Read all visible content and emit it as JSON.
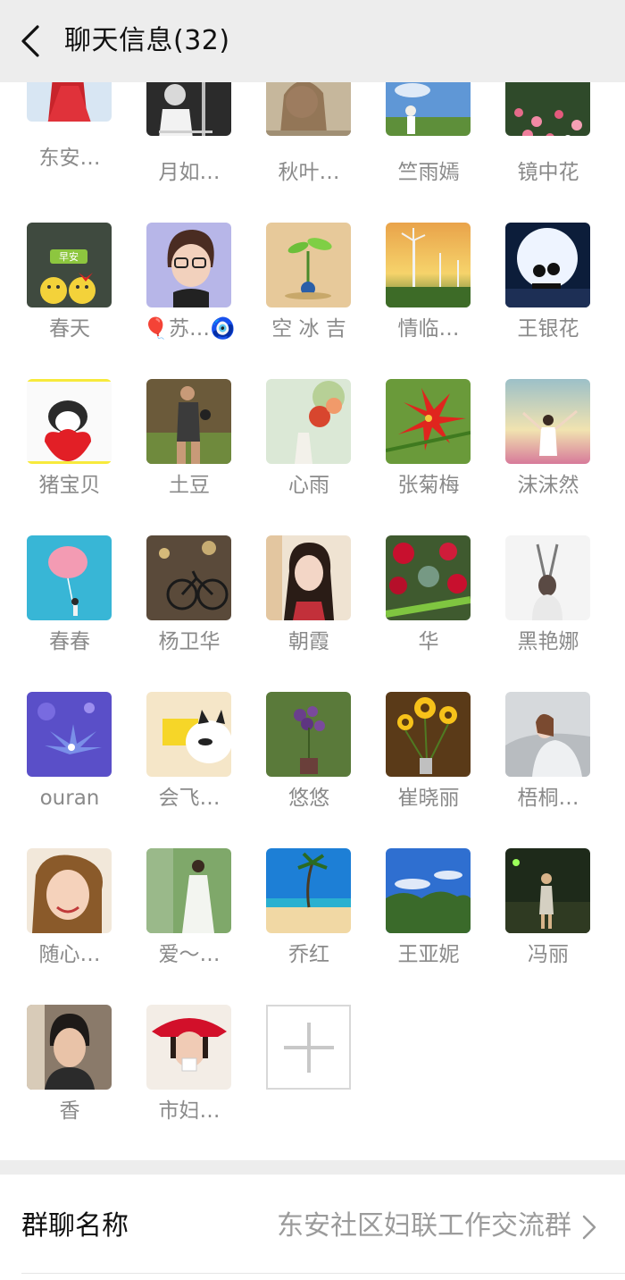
{
  "header": {
    "title": "聊天信息(32)"
  },
  "members": [
    {
      "name": "东安…",
      "avatar": "red-dress-photo"
    },
    {
      "name": "月如…",
      "avatar": "woman-bw-photo"
    },
    {
      "name": "秋叶…",
      "avatar": "woman-soft-photo"
    },
    {
      "name": "竺雨嫣",
      "avatar": "meadow-sky-photo"
    },
    {
      "name": "镜中花",
      "avatar": "flower-field-photo"
    },
    {
      "name": "春天",
      "avatar": "good-morning-smileys"
    },
    {
      "name": "🎈苏…🧿",
      "avatar": "cartoon-glasses-girl"
    },
    {
      "name": "空 冰 吉",
      "avatar": "sprout-globe"
    },
    {
      "name": "情临…",
      "avatar": "wind-turbines-sunset"
    },
    {
      "name": "王银花",
      "avatar": "moon-silhouette"
    },
    {
      "name": "猪宝贝",
      "avatar": "puppy-red-heart"
    },
    {
      "name": "土豆",
      "avatar": "woman-camera-photo"
    },
    {
      "name": "心雨",
      "avatar": "flowers-blur"
    },
    {
      "name": "张菊梅",
      "avatar": "red-lily"
    },
    {
      "name": "沫沫然",
      "avatar": "girl-sunset-field"
    },
    {
      "name": "春春",
      "avatar": "pink-cotton-candy"
    },
    {
      "name": "杨卫华",
      "avatar": "bicycle-street"
    },
    {
      "name": "朝霞",
      "avatar": "girl-portrait"
    },
    {
      "name": "华",
      "avatar": "red-roses-dew"
    },
    {
      "name": "黑艳娜",
      "avatar": "woman-arms-raised"
    },
    {
      "name": "ouran",
      "avatar": "purple-flower"
    },
    {
      "name": "会飞…",
      "avatar": "cat-yellow-shirt"
    },
    {
      "name": "悠悠",
      "avatar": "purple-orchids"
    },
    {
      "name": "崔晓丽",
      "avatar": "sunflowers-vase"
    },
    {
      "name": "梧桐…",
      "avatar": "woman-scarf-steps"
    },
    {
      "name": "随心…",
      "avatar": "smiling-woman-hat"
    },
    {
      "name": "爱～…",
      "avatar": "woman-white-dress"
    },
    {
      "name": "乔红",
      "avatar": "beach-palm"
    },
    {
      "name": "王亚妮",
      "avatar": "trees-blue-sky"
    },
    {
      "name": "冯丽",
      "avatar": "night-street-woman"
    },
    {
      "name": "香",
      "avatar": "woman-selfie"
    },
    {
      "name": "市妇…",
      "avatar": "woman-red-hat-tea"
    }
  ],
  "add_member_icon": "plus-icon",
  "group_name_row": {
    "label": "群聊名称",
    "value": "东安社区妇联工作交流群"
  },
  "colors": {
    "header_bg": "#ededed",
    "name_text": "#8a8a8a",
    "value_text": "#9b9b9b"
  }
}
